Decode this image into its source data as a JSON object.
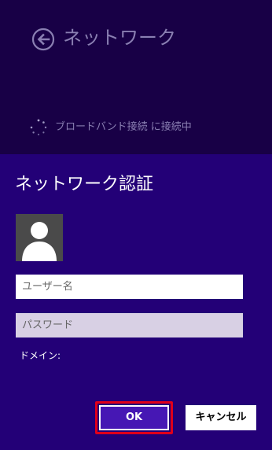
{
  "network_pane": {
    "title": "ネットワーク",
    "status": "ブロードバンド接続 に接続中"
  },
  "auth_dialog": {
    "title": "ネットワーク認証",
    "username": {
      "placeholder": "ユーザー名",
      "value": ""
    },
    "password": {
      "placeholder": "パスワード",
      "value": ""
    },
    "domain_label": "ドメイン:",
    "ok_label": "OK",
    "cancel_label": "キャンセル"
  },
  "colors": {
    "top_background": "#180046",
    "dialog_background": "#230077",
    "ok_button": "#4617b4",
    "highlight": "#e0001a",
    "dim_text": "#8a7fb2"
  },
  "icons": {
    "back": "back-arrow-icon",
    "spinner": "spinner-icon",
    "avatar": "user-silhouette-icon"
  }
}
